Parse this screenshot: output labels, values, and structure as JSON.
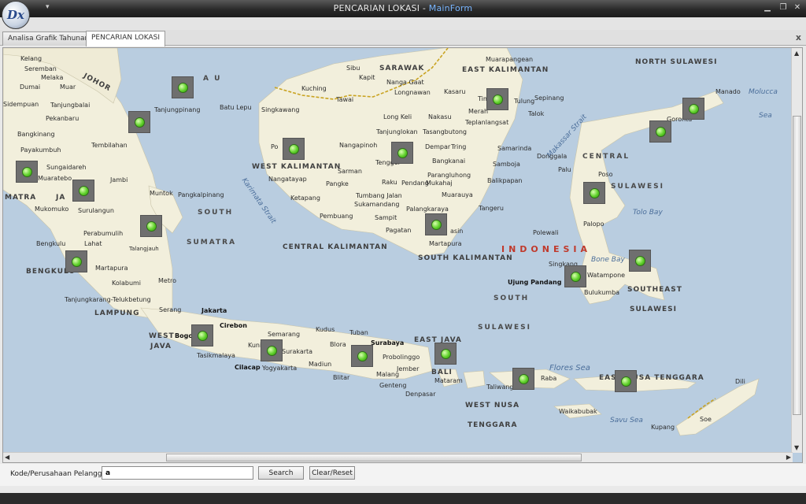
{
  "window": {
    "title_main": "PENCARIAN LOKASI - ",
    "title_accent": "MainForm",
    "app_logo_text": "Dx",
    "minimize_icon": "minimize-icon",
    "maximize_icon": "maximize-icon",
    "close_icon": "close-icon"
  },
  "tabs": [
    {
      "label": "Analisa Grafik Tahunan",
      "active": false
    },
    {
      "label": "PENCARIAN LOKASI",
      "active": true
    }
  ],
  "tab_close_glyph": "x",
  "map": {
    "labels": {
      "north_sulawesi": "NORTH SULAWESI",
      "sarawak": "SARAWAK",
      "east_kalimantan": "EAST KALIMANTAN",
      "west_kalimantan": "WEST KALIMANTAN",
      "central_kalimantan": "CENTRAL KALIMANTAN",
      "south_kalimantan": "SOUTH KALIMANTAN",
      "central": "CENTRAL",
      "sulawesi": "SULAWESI",
      "south": "SOUTH",
      "south_sumatra": "SUMATRA",
      "south_word": "SOUTH",
      "indonesia": "INDONESIA",
      "south_sulawesi_1": "SOUTH",
      "south_sulawesi_2": "SULAWESI",
      "southeast": "SOUTHEAST",
      "southeast_sulawesi": "SULAWESI",
      "bengkulu": "BENGKULU",
      "lampung": "LAMPUNG",
      "west_java_1": "WEST",
      "west_java_2": "JAVA",
      "east_java": "EAST JAVA",
      "bali": "BALI",
      "west_nusa": "WEST NUSA",
      "tenggara": "TENGGARA",
      "east_nusa": "EAST NUSA TENGGARA",
      "riau_a": "A U",
      "jambi_area": "JA",
      "matra": "MATRA"
    },
    "seas": {
      "molucca": "Molucca",
      "sea": "Sea",
      "makassar": "Makassar Strait",
      "karimata": "Karimata Strait",
      "tolo": "Tolo Bay",
      "bone": "Bone Bay",
      "flores": "Flores Sea",
      "savu": "Savu Sea",
      "batu_lepu": "Batu Lepu"
    },
    "cities": {
      "kelang": "Kelang",
      "seremban": "Seremban",
      "melaka": "Melaka",
      "muar": "Muar",
      "dumai": "Dumai",
      "johor": "JOHOR",
      "sidempuan": "Sidempuan",
      "tanjungbalai": "Tanjungbalai",
      "pekanbaru": "Pekanbaru",
      "bangkinang": "Bangkinang",
      "payakumbuh": "Payakumbuh",
      "tembilahan": "Tembilahan",
      "sungaidareh": "Sungaidareh",
      "muaratebo": "Muaratebo",
      "jambi": "Jambi",
      "mukomuko": "Mukomuko",
      "surulangun": "Surulangun",
      "perabumulih": "Perabumulih",
      "bengkulu": "Bengkulu",
      "lahat": "Lahat",
      "talangjauh": "Talangjauh",
      "martapura_s": "Martapura",
      "kolabumi": "Kolabumi",
      "metro": "Metro",
      "tanjungkarang": "Tanjungkarang-Telukbetung",
      "tanjungpinang": "Tanjungpinang",
      "muntok": "Muntok",
      "pangkalpinang": "Pangkalpinang",
      "sibu": "Sibu",
      "kapit": "Kapit",
      "kuching": "Kuching",
      "tawau_k": "Tawai",
      "singkawang": "Singkawang",
      "nanga_gaat": "Nanga Gaat",
      "longnawan": "Longnawan",
      "long_keli": "Long Keli",
      "nakasu": "Nakasu",
      "kasaru": "Kasaru",
      "tanjunglokan": "Tanjunglokan",
      "tasangbutong": "Tasangbutong",
      "nangapinoh": "Nangapinoh",
      "pontianak": "Po",
      "tengger": "Tengger",
      "dempar": "Dempar",
      "tring": "Tring",
      "bangkanai": "Bangkanai",
      "sarman": "Sarman",
      "raku": "Raku",
      "pendang": "Pendang",
      "mukahaj": "Mukahaj",
      "parangluhong": "Parangluhong",
      "nangataya": "Nangatayap",
      "ketapang": "Ketapang",
      "pangke": "Pangke",
      "tumbang_jalan": "Tumbang Jalan",
      "sukamandang": "Sukamandang",
      "muarauya": "Muarauya",
      "pembuang": "Pembuang",
      "sampit": "Sampit",
      "palangkaraya": "Palangkaraya",
      "tangeru": "Tangeru",
      "pagatan": "Pagatan",
      "basin": "asin",
      "martapura_k": "Martapura",
      "muarapangean": "Muarapangean",
      "merah": "Merah",
      "tim": "Tim",
      "tulung": "Tulung",
      "sepinang": "Sepinang",
      "talok": "Talok",
      "teplanlangsat": "Teplanlangsat",
      "samarinda": "Samarinda",
      "samboja": "Samboja",
      "balikpapan": "Balikpapan",
      "manado": "Manado",
      "goronta": "Goronta",
      "donggala": "Donggala",
      "palu": "Palu",
      "poso": "Poso",
      "polewali": "Polewali",
      "palopo": "Palopo",
      "singkang": "Singkang",
      "watampone": "Watampone",
      "ujung_pandang": "Ujung Pandang",
      "bulukumba": "Bulukumba",
      "jakarta": "Jakarta",
      "serang": "Serang",
      "bogor": "Bogo",
      "bandung": "B",
      "cirebon": "Cirebon",
      "kuningan": "Kuni",
      "tasikmalaya": "Tasikmalaya",
      "cilacap": "Cilacap",
      "semarang": "Semarang",
      "kudus": "Kudus",
      "tuban": "Tuban",
      "surakarta": "Surakarta",
      "yogyakarta": "Yogyakarta",
      "blora": "Blora",
      "madiun": "Madiun",
      "surabaya": "Surabaya",
      "probolinggo": "Probolinggo",
      "malang": "Malang",
      "jember": "Jember",
      "blitar": "Blitar",
      "genteng": "Genteng",
      "mataram": "Mataram",
      "denpasar": "Denpasar",
      "taliwang": "Taliwang",
      "raba": "Raba",
      "waikabubak": "Waikabubak",
      "kupang": "Kupang",
      "soe": "Soe",
      "dili": "Dili",
      "ra": "Ra"
    }
  },
  "search": {
    "label": "Kode/Perusahaan Pelanggan",
    "value": "a",
    "search_button": "Search",
    "clear_button": "Clear/Reset"
  }
}
